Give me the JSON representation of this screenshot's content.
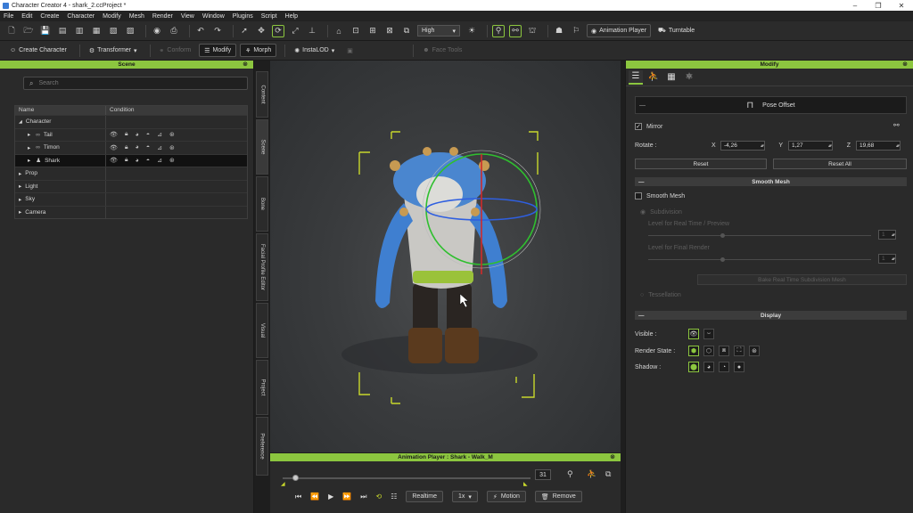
{
  "window": {
    "title": "Character Creator 4 - shark_2.ccProject *",
    "min": "–",
    "max": "❐",
    "close": "✕"
  },
  "menu": [
    "File",
    "Edit",
    "Create",
    "Character",
    "Modify",
    "Mesh",
    "Render",
    "View",
    "Window",
    "Plugins",
    "Script",
    "Help"
  ],
  "toolbar1": {
    "quality": "High",
    "animation_player": "Animation Player",
    "turntable": "Turntable"
  },
  "toolbar2": {
    "create_character": "Create Character",
    "transformer": "Transformer",
    "conform": "Conform",
    "modify": "Modify",
    "morph": "Morph",
    "instalod": "InstaLOD",
    "face_tools": "Face Tools"
  },
  "scene": {
    "title": "Scene",
    "search_placeholder": "Search",
    "columns": {
      "name": "Name",
      "condition": "Condition"
    },
    "rows": [
      {
        "label": "Character",
        "expander": "◢"
      },
      {
        "label": "Tail",
        "expander": "▸"
      },
      {
        "label": "Timon",
        "expander": "▸"
      },
      {
        "label": "Shark",
        "expander": "▸"
      },
      {
        "label": "Prop",
        "expander": "▸"
      },
      {
        "label": "Light",
        "expander": "▸"
      },
      {
        "label": "Sky",
        "expander": "▸"
      },
      {
        "label": "Camera",
        "expander": "▸"
      }
    ]
  },
  "side_tabs": [
    "Content",
    "Scene",
    "Bone",
    "Facial Profile Editor",
    "Visual",
    "Project",
    "Preference"
  ],
  "animation_player": {
    "title": "Animation Player : Shark - Walk_M",
    "frame": "31",
    "progress": 0.04,
    "realtime": "Realtime",
    "speed": "1x",
    "motion": "Motion",
    "remove": "Remove"
  },
  "modify": {
    "title": "Modify",
    "pose_offset": "Pose Offset",
    "mirror": "Mirror",
    "rotate_label": "Rotate :",
    "x_label": "X",
    "x_value": "-4,26",
    "y_label": "Y",
    "y_value": "1,27",
    "z_label": "Z",
    "z_value": "19,68",
    "reset": "Reset",
    "reset_all": "Reset All",
    "smooth_mesh_section": "Smooth Mesh",
    "smooth_mesh": "Smooth Mesh",
    "subdivision": "Subdivision",
    "level_realtime": "Level for Real Time / Preview",
    "level_realtime_value": "1",
    "level_final": "Level for Final Render",
    "level_final_value": "1",
    "bake_btn": "Bake Real Time Subdivision Mesh",
    "tessellation": "Tessellation",
    "display_section": "Display",
    "visible": "Visible :",
    "render_state": "Render State :",
    "shadow": "Shadow :",
    "collapse": "—"
  },
  "colors": {
    "accent": "#8cc63f",
    "panel": "#2a2a2a",
    "viewport": "#3a3c3e"
  }
}
